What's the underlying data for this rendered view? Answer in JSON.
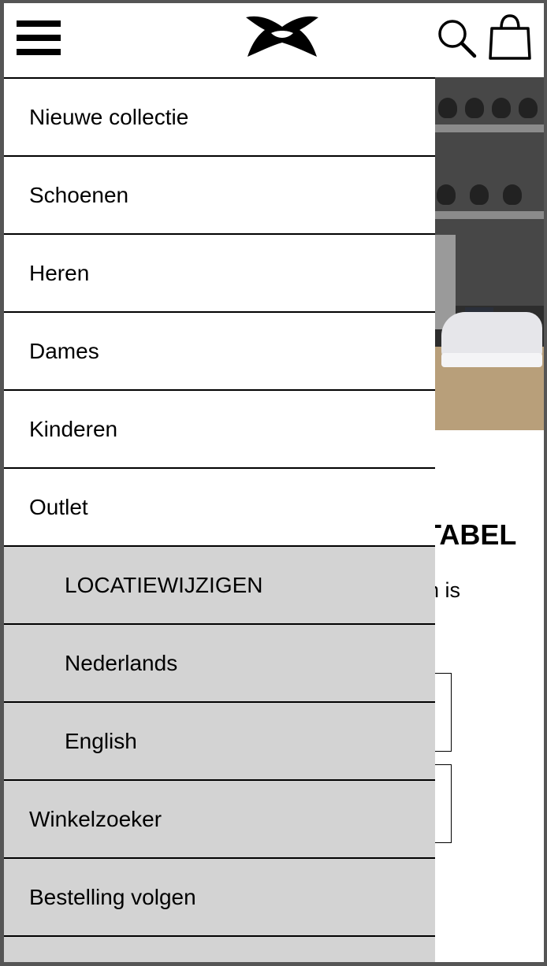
{
  "header": {
    "menu_icon": "hamburger-menu-icon",
    "logo": "under-armour-logo",
    "search_icon": "search-icon",
    "cart_icon": "shopping-bag-icon"
  },
  "background": {
    "heading_fragment": "TABEL",
    "text_fragment": "n is"
  },
  "menu": {
    "items": [
      {
        "label": "Nieuwe collectie",
        "style": "primary"
      },
      {
        "label": "Schoenen",
        "style": "primary"
      },
      {
        "label": "Heren",
        "style": "primary"
      },
      {
        "label": "Dames",
        "style": "primary"
      },
      {
        "label": "Kinderen",
        "style": "primary"
      },
      {
        "label": "Outlet",
        "style": "primary"
      },
      {
        "label": "LOCATIEWIJZIGEN",
        "style": "sub"
      },
      {
        "label": "Nederlands",
        "style": "sub"
      },
      {
        "label": "English",
        "style": "sub"
      },
      {
        "label": "Winkelzoeker",
        "style": "secondary"
      },
      {
        "label": "Bestelling volgen",
        "style": "secondary"
      },
      {
        "label": "",
        "style": "secondary"
      }
    ]
  },
  "colors": {
    "menu_primary_bg": "#ffffff",
    "menu_secondary_bg": "#d3d3d3",
    "text": "#000000",
    "frame": "#555555"
  }
}
